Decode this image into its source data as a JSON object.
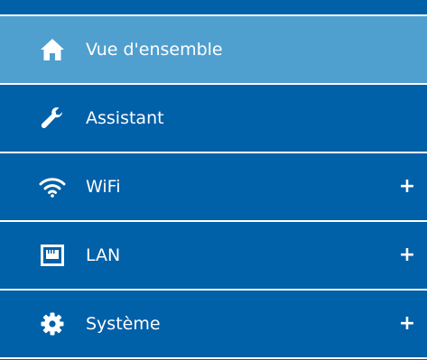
{
  "menu": {
    "items": [
      {
        "label": "Vue d'ensemble",
        "icon": "home-icon",
        "active": true,
        "expandable": false
      },
      {
        "label": "Assistant",
        "icon": "wrench-icon",
        "active": false,
        "expandable": false
      },
      {
        "label": "WiFi",
        "icon": "wifi-icon",
        "active": false,
        "expandable": true,
        "expand_symbol": "+"
      },
      {
        "label": "LAN",
        "icon": "lan-port-icon",
        "active": false,
        "expandable": true,
        "expand_symbol": "+"
      },
      {
        "label": "Système",
        "icon": "gear-icon",
        "active": false,
        "expandable": true,
        "expand_symbol": "+"
      }
    ]
  },
  "colors": {
    "menu_background": "#0060a8",
    "active_background": "#4f9fcf",
    "divider": "#ffffff",
    "text": "#ffffff"
  }
}
